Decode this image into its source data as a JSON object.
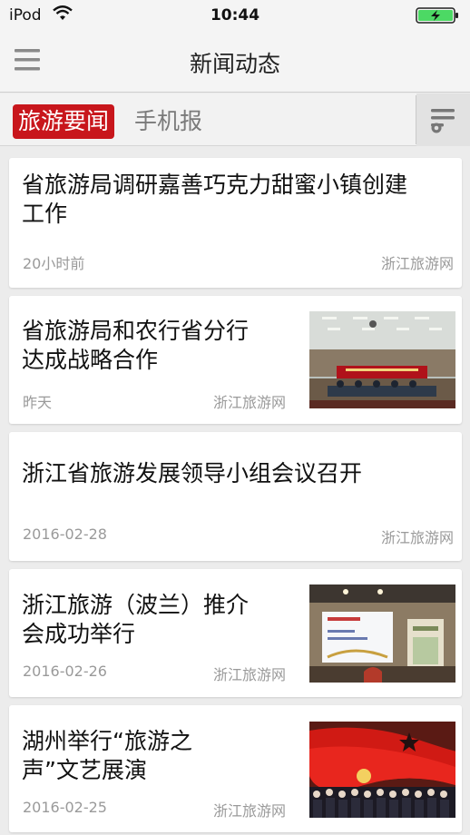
{
  "status": {
    "carrier": "iPod",
    "time": "10:44"
  },
  "nav": {
    "title": "新闻动态"
  },
  "tabs": [
    {
      "label": "旅游要闻",
      "active": true
    },
    {
      "label": "手机报",
      "active": false
    }
  ],
  "colors": {
    "accent": "#c8161c",
    "battery": "#4cd964"
  },
  "icons": {
    "menu": "hamburger-menu-icon",
    "filter": "filter-list-icon",
    "wifi": "wifi-icon",
    "battery": "battery-charging-icon"
  },
  "news": [
    {
      "headline_line1": "省旅游局调研嘉善巧克力甜蜜小镇创建",
      "headline_line2": "工作",
      "date": "20小时前",
      "source": "浙江旅游网",
      "thumb": ""
    },
    {
      "headline_line1": "省旅游局和农行省分行",
      "headline_line2": "达成战略合作",
      "date": "昨天",
      "source": "浙江旅游网",
      "thumb": "meeting-room-photo"
    },
    {
      "headline_line1": "浙江省旅游发展领导小组会议召开",
      "headline_line2": "",
      "date": "2016-02-28",
      "source": "浙江旅游网",
      "thumb": ""
    },
    {
      "headline_line1": "浙江旅游（波兰）推介",
      "headline_line2": "会成功举行",
      "date": "2016-02-26",
      "source": "浙江旅游网",
      "thumb": "presentation-photo"
    },
    {
      "headline_line1": "湖州举行“旅游之",
      "headline_line2": "声”文艺展演",
      "date": "2016-02-25",
      "source": "浙江旅游网",
      "thumb": "red-flag-performance-photo"
    }
  ]
}
